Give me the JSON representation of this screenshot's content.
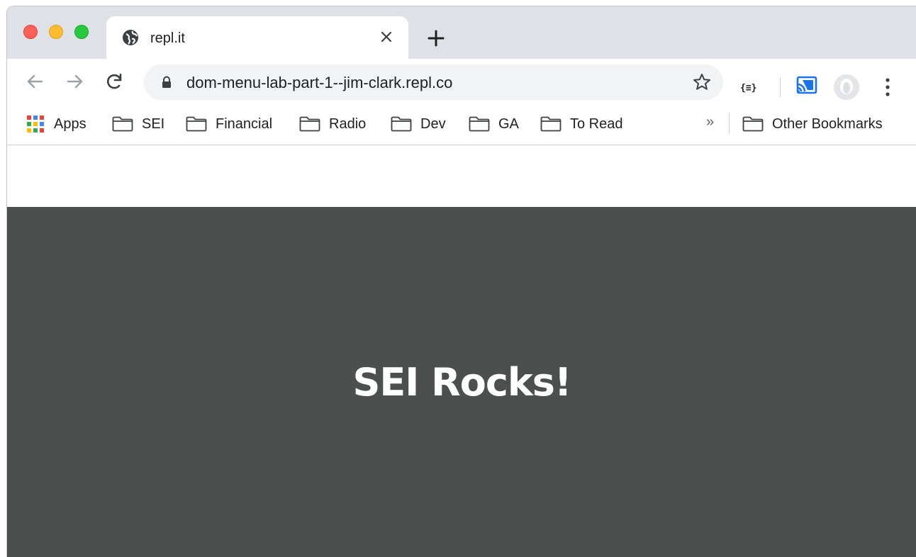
{
  "tab": {
    "title": "repl.it"
  },
  "toolbar": {
    "url": "dom-menu-lab-part-1--jim-clark.repl.co",
    "ext_label": "{≡}"
  },
  "bookmarks": {
    "apps": "Apps",
    "items": [
      {
        "label": "SEI"
      },
      {
        "label": "Financial"
      },
      {
        "label": "Radio"
      },
      {
        "label": "Dev"
      },
      {
        "label": "GA"
      },
      {
        "label": "To Read"
      }
    ],
    "overflow": "»",
    "other": "Other Bookmarks"
  },
  "page": {
    "heading": "SEI Rocks!",
    "hero_bg": "#4b4f4e"
  },
  "colors": {
    "tabstrip": "#dee1e6",
    "omnibox": "#f1f3f4",
    "cast": "#1a73e8"
  }
}
